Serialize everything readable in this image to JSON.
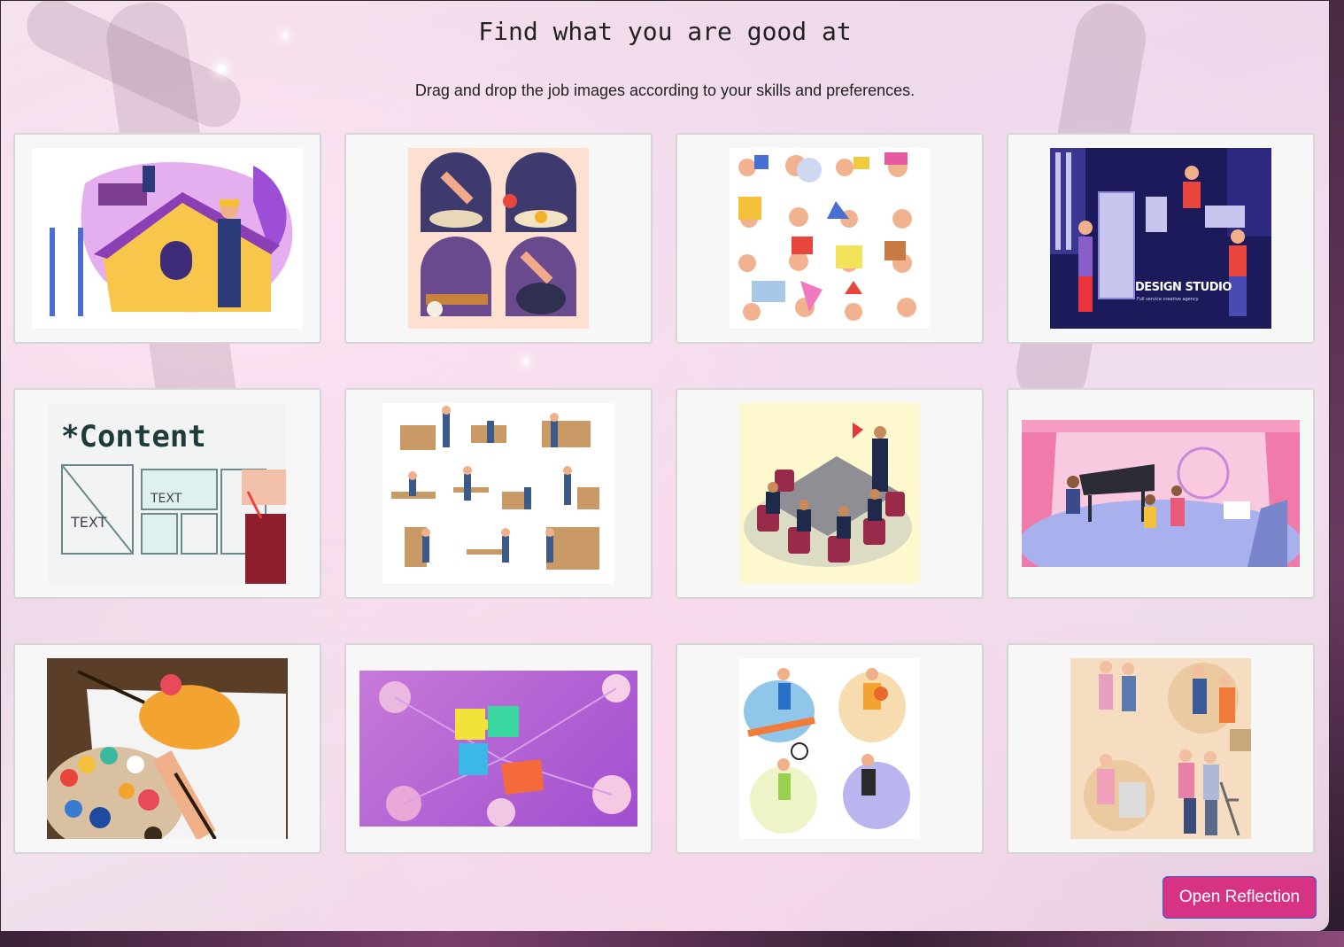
{
  "page": {
    "title": "Find what you are good at",
    "subtitle": "Drag and drop the job images according to your skills and preferences."
  },
  "cards": [
    {
      "icon": "construction-workers-house-icon"
    },
    {
      "icon": "cooking-illustration-icon"
    },
    {
      "icon": "handicrafts-collage-icon"
    },
    {
      "icon": "design-studio-illustration-icon",
      "text": "DESIGN STUDIO",
      "subtext": "Full service creative agency"
    },
    {
      "icon": "content-wireframe-sketch-icon",
      "text": "*Content"
    },
    {
      "icon": "carpenters-collage-icon"
    },
    {
      "icon": "business-meeting-icon"
    },
    {
      "icon": "music-stage-performance-icon"
    },
    {
      "icon": "painting-palette-icon"
    },
    {
      "icon": "puzzle-pieces-icon"
    },
    {
      "icon": "sports-collage-icon"
    },
    {
      "icon": "elderly-care-icon"
    }
  ],
  "actions": {
    "open_reflection": "Open Reflection"
  }
}
